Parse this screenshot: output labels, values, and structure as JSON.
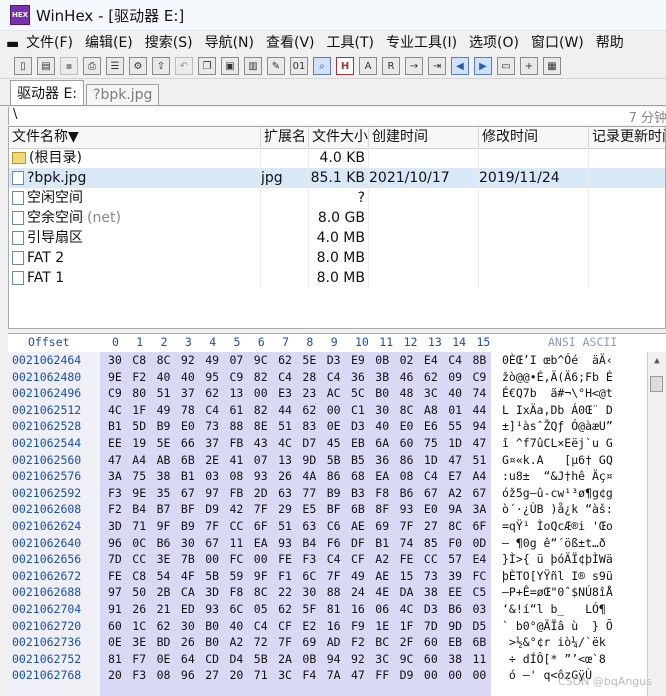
{
  "window": {
    "title": "WinHex - [驱动器 E:]",
    "logo_text": "HEX"
  },
  "menu": [
    {
      "label": "文件(F)"
    },
    {
      "label": "编辑(E)"
    },
    {
      "label": "搜索(S)"
    },
    {
      "label": "导航(N)"
    },
    {
      "label": "查看(V)"
    },
    {
      "label": "工具(T)"
    },
    {
      "label": "专业工具(I)"
    },
    {
      "label": "选项(O)"
    },
    {
      "label": "窗口(W)"
    },
    {
      "label": "帮助"
    }
  ],
  "tabs": [
    {
      "label": "驱动器 E:",
      "active": true
    },
    {
      "label": "?bpk.jpg",
      "active": false
    }
  ],
  "infobar": {
    "path": "\\",
    "status": "7 分钟"
  },
  "file_list": {
    "columns": [
      "文件名称▼",
      "扩展名",
      "文件大小",
      "创建时间",
      "修改时间",
      "记录更新时间"
    ],
    "rows": [
      {
        "name": "(根目录)",
        "ext": "",
        "size": "4.0 KB",
        "created": "",
        "modified": "",
        "suffix": ""
      },
      {
        "name": "?bpk.jpg",
        "ext": "jpg",
        "size": "85.1 KB",
        "created": "2021/10/17",
        "modified": "2019/11/24",
        "suffix": ""
      },
      {
        "name": "空闲空间",
        "ext": "",
        "size": "?",
        "created": "",
        "modified": "",
        "suffix": ""
      },
      {
        "name": "空余空间",
        "ext": "",
        "size": "8.0 GB",
        "created": "",
        "modified": "",
        "suffix": "(net)"
      },
      {
        "name": "引导扇区",
        "ext": "",
        "size": "4.0 MB",
        "created": "",
        "modified": "",
        "suffix": ""
      },
      {
        "name": "FAT 2",
        "ext": "",
        "size": "8.0 MB",
        "created": "",
        "modified": "",
        "suffix": ""
      },
      {
        "name": "FAT 1",
        "ext": "",
        "size": "8.0 MB",
        "created": "",
        "modified": "",
        "suffix": ""
      }
    ]
  },
  "hex": {
    "offset_label": "Offset",
    "column_headers": [
      "0",
      "1",
      "2",
      "3",
      "4",
      "5",
      "6",
      "7",
      "8",
      "9",
      "10",
      "11",
      "12",
      "13",
      "14",
      "15"
    ],
    "ascii_label": "ANSI ASCII",
    "rows": [
      {
        "offset": "0021062464",
        "bytes": [
          "30",
          "C8",
          "8C",
          "92",
          "49",
          "07",
          "9C",
          "62",
          "5E",
          "D3",
          "E9",
          "0B",
          "02",
          "E4",
          "C4",
          "8B"
        ],
        "ascii": "0ÈŒ’I œb^Óé  äÄ‹"
      },
      {
        "offset": "0021062480",
        "bytes": [
          "9E",
          "F2",
          "40",
          "40",
          "95",
          "C9",
          "82",
          "C4",
          "28",
          "C4",
          "36",
          "3B",
          "46",
          "62",
          "09",
          "C9"
        ],
        "ascii": "žò@@•É‚Ä(Ä6;Fb É"
      },
      {
        "offset": "0021062496",
        "bytes": [
          "C9",
          "80",
          "51",
          "37",
          "62",
          "13",
          "00",
          "E3",
          "23",
          "AC",
          "5C",
          "B0",
          "48",
          "3C",
          "40",
          "74"
        ],
        "ascii": "É€Q7b  ã#¬\\°H<@t"
      },
      {
        "offset": "0021062512",
        "bytes": [
          "4C",
          "1F",
          "49",
          "78",
          "C4",
          "61",
          "82",
          "44",
          "62",
          "00",
          "C1",
          "30",
          "8C",
          "A8",
          "01",
          "44"
        ],
        "ascii": "L IxÄa‚Db Á0Œ¨ D"
      },
      {
        "offset": "0021062528",
        "bytes": [
          "B1",
          "5D",
          "B9",
          "E0",
          "73",
          "88",
          "8E",
          "51",
          "83",
          "0E",
          "D3",
          "40",
          "E0",
          "E6",
          "55",
          "94"
        ],
        "ascii": "±]¹àsˆŽQƒ Ó@àæU”"
      },
      {
        "offset": "0021062544",
        "bytes": [
          "EE",
          "19",
          "5E",
          "66",
          "37",
          "FB",
          "43",
          "4C",
          "D7",
          "45",
          "EB",
          "6A",
          "60",
          "75",
          "1D",
          "47"
        ],
        "ascii": "î ^f7ûCL×Eëj`u G"
      },
      {
        "offset": "0021062560",
        "bytes": [
          "47",
          "A4",
          "AB",
          "6B",
          "2E",
          "41",
          "07",
          "13",
          "9D",
          "5B",
          "B5",
          "36",
          "86",
          "1D",
          "47",
          "51"
        ],
        "ascii": "G¤«k.A   [µ6† GQ"
      },
      {
        "offset": "0021062576",
        "bytes": [
          "3A",
          "75",
          "38",
          "B1",
          "03",
          "08",
          "93",
          "26",
          "4A",
          "86",
          "68",
          "EA",
          "08",
          "C4",
          "E7",
          "A4"
        ],
        "ascii": ":u8±  “&J†hê Äç¤"
      },
      {
        "offset": "0021062592",
        "bytes": [
          "F3",
          "9E",
          "35",
          "67",
          "97",
          "FB",
          "2D",
          "63",
          "77",
          "B9",
          "B3",
          "F8",
          "B6",
          "67",
          "A2",
          "67"
        ],
        "ascii": "óž5g—û-cw¹³ø¶g¢g"
      },
      {
        "offset": "0021062608",
        "bytes": [
          "F2",
          "B4",
          "B7",
          "BF",
          "D9",
          "42",
          "7F",
          "29",
          "E5",
          "BF",
          "6B",
          "8F",
          "93",
          "E0",
          "9A",
          "3A"
        ],
        "ascii": "ò´·¿ÙB )å¿k “àš:"
      },
      {
        "offset": "0021062624",
        "bytes": [
          "3D",
          "71",
          "9F",
          "B9",
          "7F",
          "CC",
          "6F",
          "51",
          "63",
          "C6",
          "AE",
          "69",
          "7F",
          "27",
          "8C",
          "6F"
        ],
        "ascii": "=qŸ¹ ÌoQcÆ®i 'Œo"
      },
      {
        "offset": "0021062640",
        "bytes": [
          "96",
          "0C",
          "B6",
          "30",
          "67",
          "11",
          "EA",
          "93",
          "B4",
          "F6",
          "DF",
          "B1",
          "74",
          "85",
          "F0",
          "0D"
        ],
        "ascii": "– ¶0g ê“´öß±t…ð "
      },
      {
        "offset": "0021062656",
        "bytes": [
          "7D",
          "CC",
          "3E",
          "7B",
          "00",
          "FC",
          "00",
          "FE",
          "F3",
          "C4",
          "CF",
          "A2",
          "FE",
          "CC",
          "57",
          "E4"
        ],
        "ascii": "}Ì>{ ü þóÄÏ¢þÌWä"
      },
      {
        "offset": "0021062672",
        "bytes": [
          "FE",
          "C8",
          "54",
          "4F",
          "5B",
          "59",
          "9F",
          "F1",
          "6C",
          "7F",
          "49",
          "AE",
          "15",
          "73",
          "39",
          "FC"
        ],
        "ascii": "þÈTO[YŸñl I® s9ü"
      },
      {
        "offset": "0021062688",
        "bytes": [
          "97",
          "50",
          "2B",
          "CA",
          "3D",
          "F8",
          "8C",
          "22",
          "30",
          "88",
          "24",
          "4E",
          "DA",
          "38",
          "EE",
          "C5"
        ],
        "ascii": "—P+Ê=øŒ\"0ˆ$NÚ8îÅ"
      },
      {
        "offset": "0021062704",
        "bytes": [
          "91",
          "26",
          "21",
          "ED",
          "93",
          "6C",
          "05",
          "62",
          "5F",
          "81",
          "16",
          "06",
          "4C",
          "D3",
          "B6",
          "03"
        ],
        "ascii": "‘&!í“l b_   LÓ¶ "
      },
      {
        "offset": "0021062720",
        "bytes": [
          "60",
          "1C",
          "62",
          "30",
          "B0",
          "40",
          "C4",
          "CF",
          "E2",
          "16",
          "F9",
          "1E",
          "1F",
          "7D",
          "9D",
          "D5"
        ],
        "ascii": "` b0°@ÄÏâ ù  } Õ"
      },
      {
        "offset": "0021062736",
        "bytes": [
          "0E",
          "3E",
          "BD",
          "26",
          "B0",
          "A2",
          "72",
          "7F",
          "69",
          "AD",
          "F2",
          "BC",
          "2F",
          "60",
          "EB",
          "6B"
        ],
        "ascii": " >½&°¢r i­ò¼/`ëk"
      },
      {
        "offset": "0021062752",
        "bytes": [
          "81",
          "F7",
          "0E",
          "64",
          "CD",
          "D4",
          "5B",
          "2A",
          "0B",
          "94",
          "92",
          "3C",
          "9C",
          "60",
          "38",
          "11"
        ],
        "ascii": " ÷ dÍÔ[* ”’<œ`8 "
      },
      {
        "offset": "0021062768",
        "bytes": [
          "20",
          "F3",
          "08",
          "96",
          "27",
          "20",
          "71",
          "3C",
          "F4",
          "7A",
          "47",
          "FF",
          "D9",
          "00",
          "00",
          "00"
        ],
        "ascii": " ó –' q<ôzGÿÙ   "
      }
    ]
  },
  "watermark": "CSDN @bqAngus"
}
